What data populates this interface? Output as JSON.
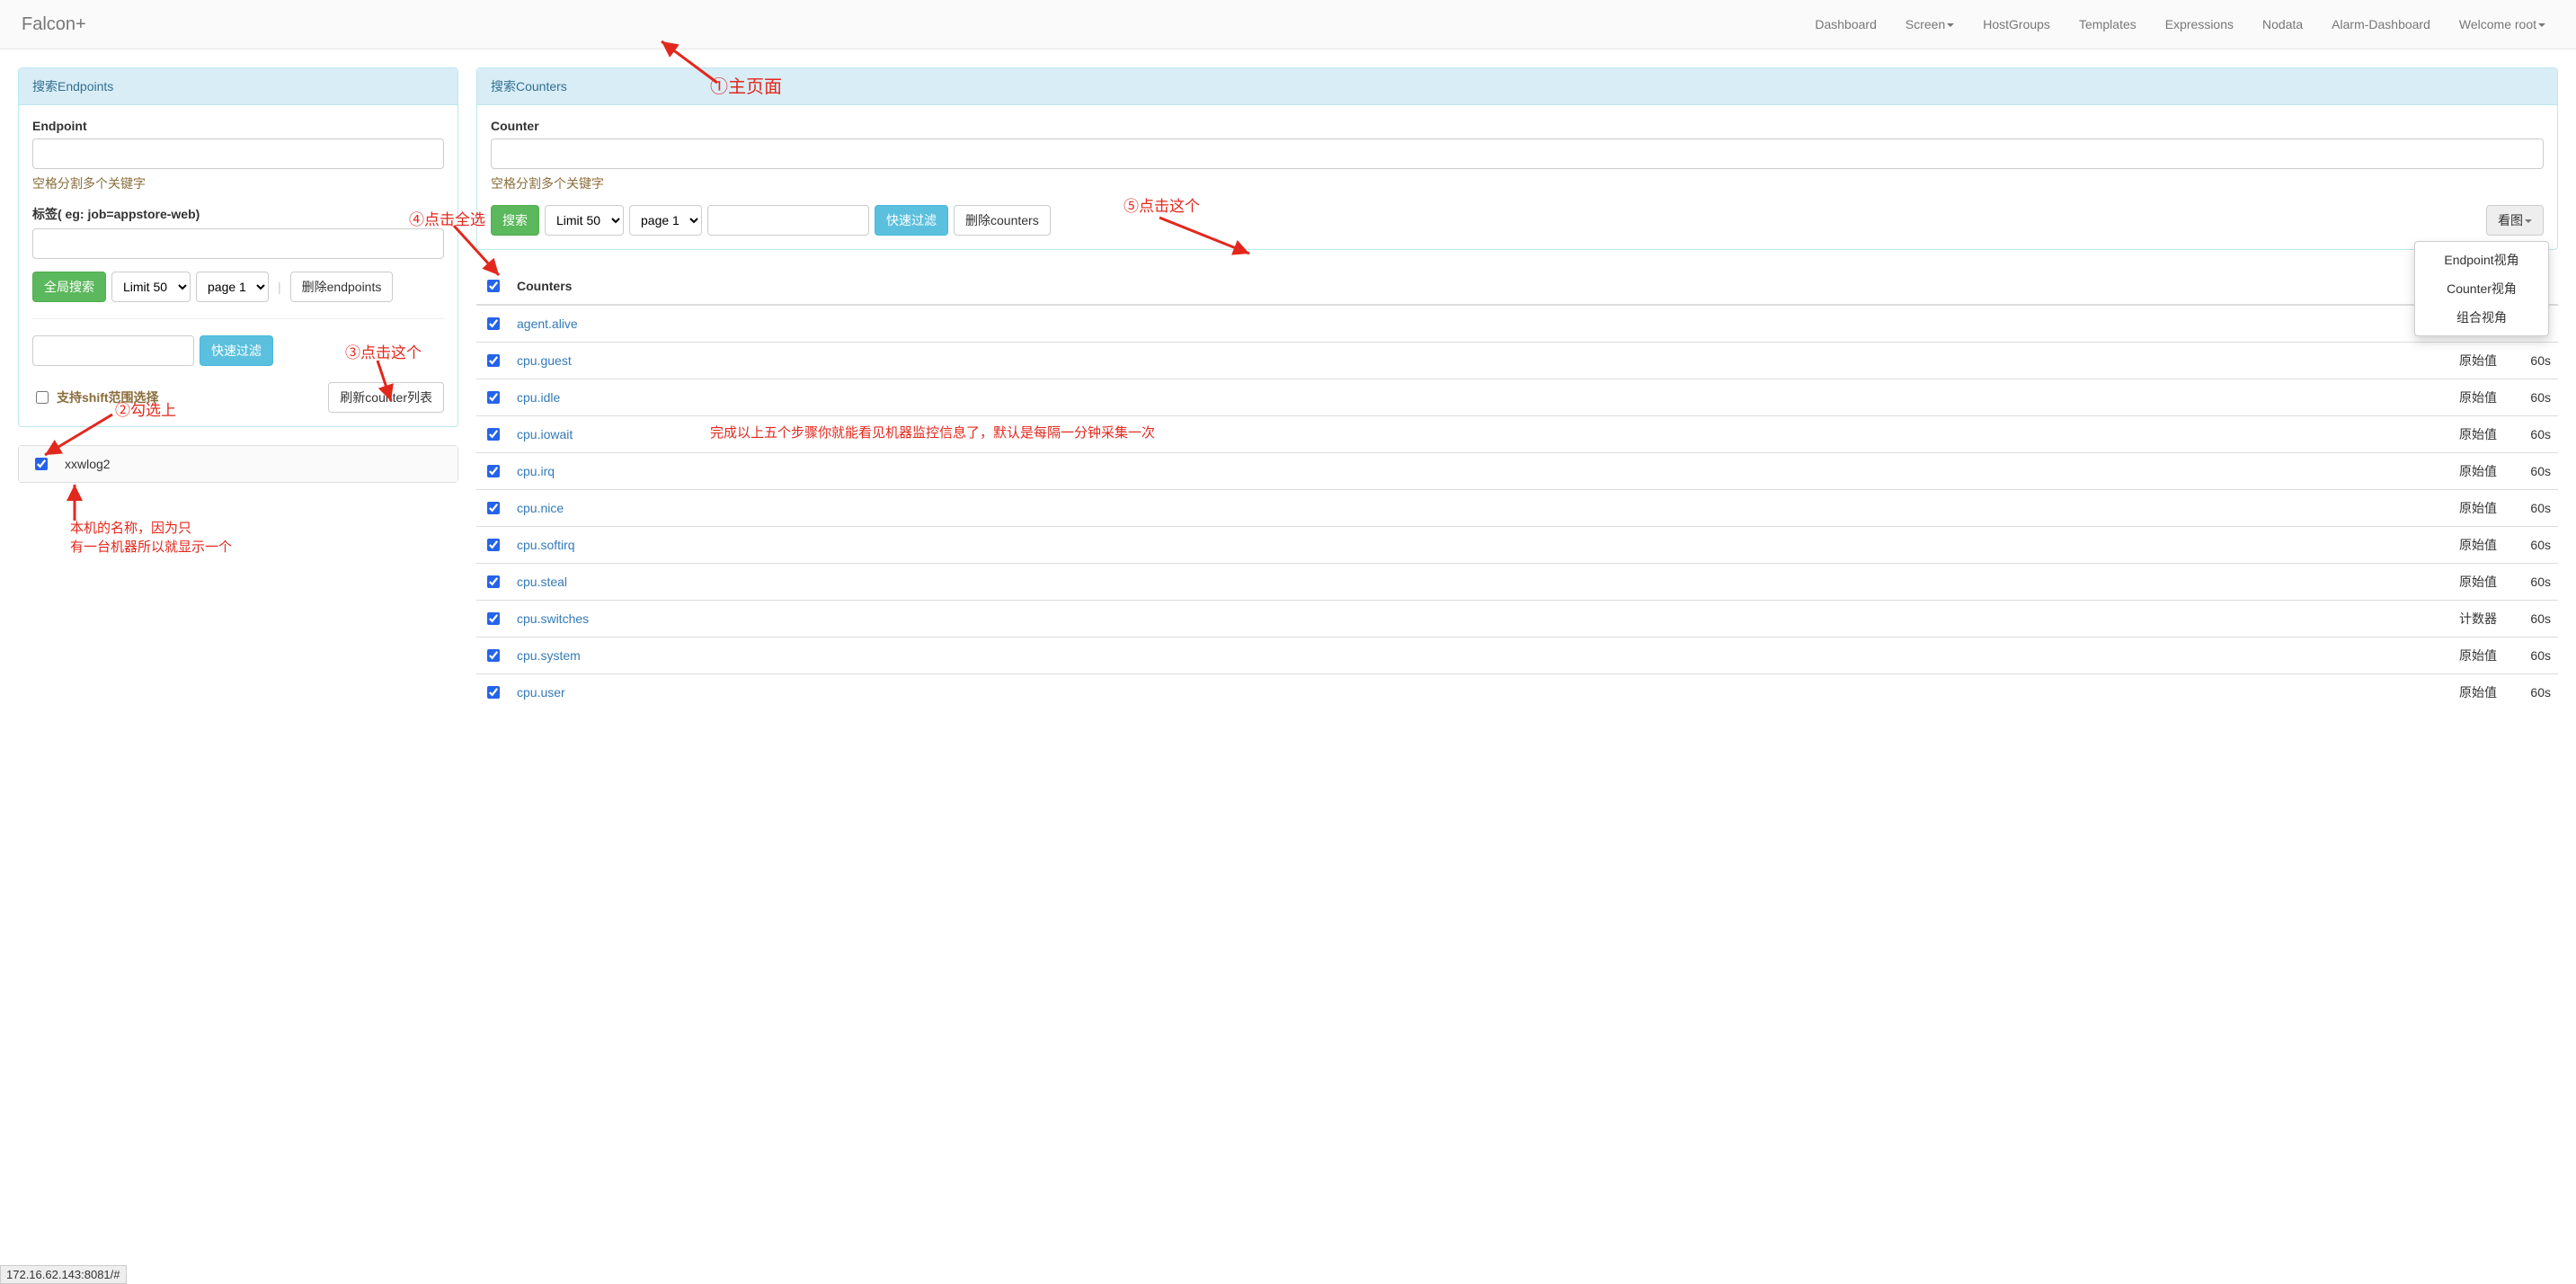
{
  "brand": "Falcon+",
  "nav": {
    "dashboard": "Dashboard",
    "screen": "Screen",
    "hostgroups": "HostGroups",
    "templates": "Templates",
    "expressions": "Expressions",
    "nodata": "Nodata",
    "alarm": "Alarm-Dashboard",
    "welcome": "Welcome root"
  },
  "left_panel": {
    "title": "搜索Endpoints",
    "endpoint_label": "Endpoint",
    "help1": "空格分割多个关键字",
    "tag_label": "标签( eg: job=appstore-web)",
    "btn_global_search": "全局搜索",
    "limit_sel": "Limit 50",
    "page_sel": "page 1",
    "btn_delete_ep": "删除endpoints",
    "btn_fast_filter": "快速过滤",
    "shift_label": "支持shift范围选择",
    "btn_refresh_counter": "刷新counter列表",
    "endpoints": [
      {
        "name": "xxwlog2",
        "checked": true
      }
    ]
  },
  "right_panel": {
    "title": "搜索Counters",
    "counter_label": "Counter",
    "help1": "空格分割多个关键字",
    "btn_search": "搜索",
    "limit_sel": "Limit 50",
    "page_sel": "page 1",
    "btn_fast_filter": "快速过滤",
    "btn_delete_counters": "删除counters",
    "btn_view": "看图",
    "view_menu": {
      "endpoint": "Endpoint视角",
      "counter": "Counter视角",
      "combo": "组合视角"
    },
    "table": {
      "header_counters": "Counters",
      "rows": [
        {
          "name": "agent.alive",
          "type": "",
          "step": ""
        },
        {
          "name": "cpu.guest",
          "type": "原始值",
          "step": "60s"
        },
        {
          "name": "cpu.idle",
          "type": "原始值",
          "step": "60s"
        },
        {
          "name": "cpu.iowait",
          "type": "原始值",
          "step": "60s"
        },
        {
          "name": "cpu.irq",
          "type": "原始值",
          "step": "60s"
        },
        {
          "name": "cpu.nice",
          "type": "原始值",
          "step": "60s"
        },
        {
          "name": "cpu.softirq",
          "type": "原始值",
          "step": "60s"
        },
        {
          "name": "cpu.steal",
          "type": "原始值",
          "step": "60s"
        },
        {
          "name": "cpu.switches",
          "type": "计数器",
          "step": "60s"
        },
        {
          "name": "cpu.system",
          "type": "原始值",
          "step": "60s"
        },
        {
          "name": "cpu.user",
          "type": "原始值",
          "step": "60s"
        }
      ]
    }
  },
  "annotations": {
    "a1": "①主页面",
    "a2": "②勾选上",
    "a3": "③点击这个",
    "a4": "④点击全选",
    "a5": "⑤点击这个",
    "note_left": "本机的名称，因为只\n有一台机器所以就显示一个",
    "note_center": "完成以上五个步骤你就能看见机器监控信息了，默认是每隔一分钟采集一次"
  },
  "status_bar": "172.16.62.143:8081/#"
}
